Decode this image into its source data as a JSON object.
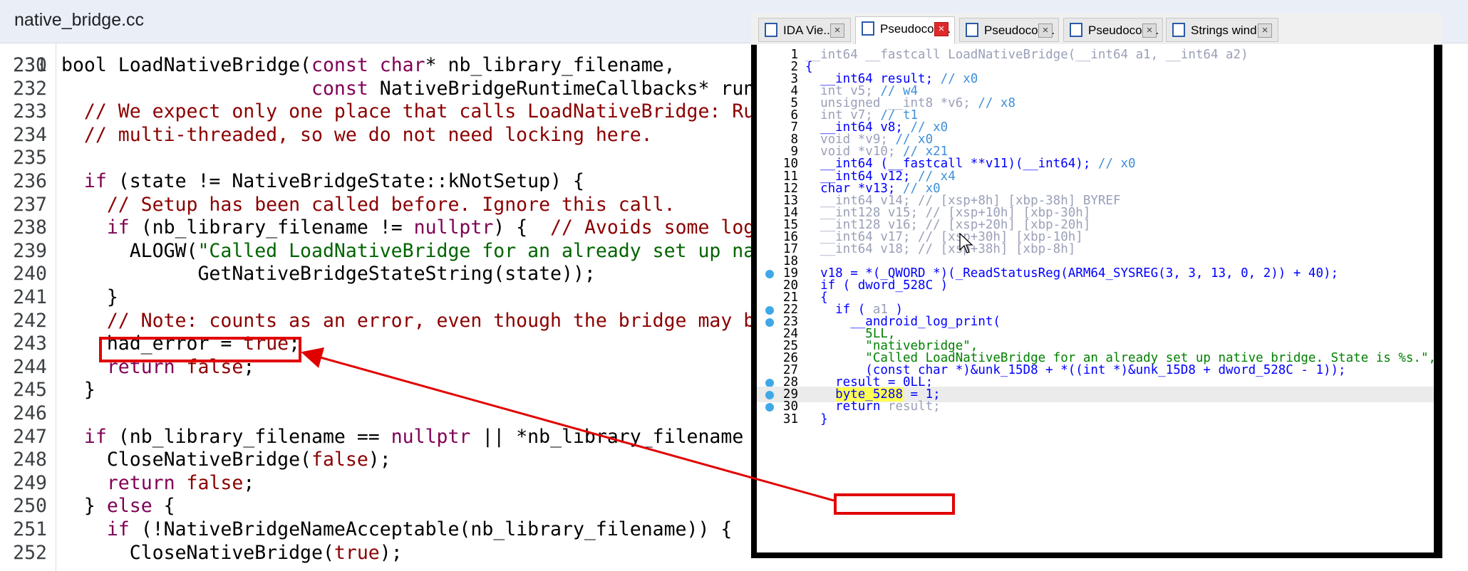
{
  "source_panel": {
    "title": "native_bridge.cc",
    "partial_top_line": "230",
    "lines": [
      {
        "num": "231",
        "segments": [
          {
            "t": "bool LoadNativeBridge(",
            "c": ""
          },
          {
            "t": "const",
            "c": "t-k"
          },
          {
            "t": " ",
            "c": ""
          },
          {
            "t": "char",
            "c": "t-k"
          },
          {
            "t": "* nb_library_filename,",
            "c": ""
          }
        ]
      },
      {
        "num": "232",
        "segments": [
          {
            "t": "                      ",
            "c": ""
          },
          {
            "t": "const",
            "c": "t-k"
          },
          {
            "t": " NativeBridgeRuntimeCallbacks* runt",
            "c": ""
          }
        ]
      },
      {
        "num": "233",
        "segments": [
          {
            "t": "  // We expect only one place that calls LoadNativeBridge: Run",
            "c": "t-c"
          }
        ]
      },
      {
        "num": "234",
        "segments": [
          {
            "t": "  // multi-threaded, so we do not need locking here.",
            "c": "t-c"
          }
        ]
      },
      {
        "num": "235",
        "segments": []
      },
      {
        "num": "236",
        "segments": [
          {
            "t": "  ",
            "c": ""
          },
          {
            "t": "if",
            "c": "t-k"
          },
          {
            "t": " (state != NativeBridgeState::kNotSetup) {",
            "c": ""
          }
        ]
      },
      {
        "num": "237",
        "segments": [
          {
            "t": "    // Setup has been called before. Ignore this call.",
            "c": "t-c"
          }
        ]
      },
      {
        "num": "238",
        "segments": [
          {
            "t": "    ",
            "c": ""
          },
          {
            "t": "if",
            "c": "t-k"
          },
          {
            "t": " (nb_library_filename != ",
            "c": ""
          },
          {
            "t": "nullptr",
            "c": "t-n"
          },
          {
            "t": ") {  ",
            "c": ""
          },
          {
            "t": "// Avoids some log-",
            "c": "t-c"
          }
        ]
      },
      {
        "num": "239",
        "segments": [
          {
            "t": "      ALOGW(",
            "c": ""
          },
          {
            "t": "\"Called LoadNativeBridge for an already set up nat",
            "c": "t-s"
          }
        ]
      },
      {
        "num": "240",
        "segments": [
          {
            "t": "            GetNativeBridgeStateString(state));",
            "c": ""
          }
        ]
      },
      {
        "num": "241",
        "segments": [
          {
            "t": "    }",
            "c": ""
          }
        ]
      },
      {
        "num": "242",
        "segments": [
          {
            "t": "    // Note: counts as an error, even though the bridge may be",
            "c": "t-c"
          }
        ]
      },
      {
        "num": "243",
        "segments": [
          {
            "t": "    had_error = ",
            "c": ""
          },
          {
            "t": "true",
            "c": "t-b"
          },
          {
            "t": ";",
            "c": ""
          }
        ]
      },
      {
        "num": "244",
        "segments": [
          {
            "t": "    ",
            "c": ""
          },
          {
            "t": "return",
            "c": "t-k"
          },
          {
            "t": " ",
            "c": ""
          },
          {
            "t": "false",
            "c": "t-b"
          },
          {
            "t": ";",
            "c": ""
          }
        ]
      },
      {
        "num": "245",
        "segments": [
          {
            "t": "  }",
            "c": ""
          }
        ]
      },
      {
        "num": "246",
        "segments": []
      },
      {
        "num": "247",
        "segments": [
          {
            "t": "  ",
            "c": ""
          },
          {
            "t": "if",
            "c": "t-k"
          },
          {
            "t": " (nb_library_filename == ",
            "c": ""
          },
          {
            "t": "nullptr",
            "c": "t-n"
          },
          {
            "t": " || *nb_library_filename =",
            "c": ""
          }
        ]
      },
      {
        "num": "248",
        "segments": [
          {
            "t": "    CloseNativeBridge(",
            "c": ""
          },
          {
            "t": "false",
            "c": "t-b"
          },
          {
            "t": ");",
            "c": ""
          }
        ]
      },
      {
        "num": "249",
        "segments": [
          {
            "t": "    ",
            "c": ""
          },
          {
            "t": "return",
            "c": "t-k"
          },
          {
            "t": " ",
            "c": ""
          },
          {
            "t": "false",
            "c": "t-b"
          },
          {
            "t": ";",
            "c": ""
          }
        ]
      },
      {
        "num": "250",
        "segments": [
          {
            "t": "  } ",
            "c": ""
          },
          {
            "t": "else",
            "c": "t-k"
          },
          {
            "t": " {",
            "c": ""
          }
        ]
      },
      {
        "num": "251",
        "segments": [
          {
            "t": "    ",
            "c": ""
          },
          {
            "t": "if",
            "c": "t-k"
          },
          {
            "t": " (!NativeBridgeNameAcceptable(nb_library_filename)) {",
            "c": ""
          }
        ]
      },
      {
        "num": "252",
        "segments": [
          {
            "t": "      CloseNativeBridge(",
            "c": ""
          },
          {
            "t": "true",
            "c": "t-b"
          },
          {
            "t": ");",
            "c": ""
          }
        ]
      }
    ]
  },
  "ida": {
    "tabs": [
      {
        "label": "IDA Vie...",
        "icon": "ida-view-icon",
        "active": false,
        "close_red": false
      },
      {
        "label": "Pseudocod...",
        "icon": "pseudocode-icon",
        "active": true,
        "close_red": true
      },
      {
        "label": "Pseudocod...",
        "icon": "pseudocode-icon",
        "active": false,
        "close_red": false
      },
      {
        "label": "Pseudocod...",
        "icon": "pseudocode-icon",
        "active": false,
        "close_red": false
      },
      {
        "label": "Strings wind...",
        "icon": "strings-icon",
        "active": false,
        "close_red": false
      }
    ],
    "lines": [
      {
        "num": "1",
        "dot": false,
        "segments": [
          {
            "t": "__int64 __fastcall LoadNativeBridge(__int64 a1, __int64 a2)",
            "c": "v-l"
          }
        ]
      },
      {
        "num": "2",
        "dot": false,
        "segments": [
          {
            "t": "{",
            "c": "v-b"
          }
        ]
      },
      {
        "num": "3",
        "dot": false,
        "segments": [
          {
            "t": "  __int64 result; ",
            "c": "v-b"
          },
          {
            "t": "// x0",
            "c": "v-c"
          }
        ]
      },
      {
        "num": "4",
        "dot": false,
        "segments": [
          {
            "t": "  int v5; ",
            "c": "v-l"
          },
          {
            "t": "// w4",
            "c": "v-c"
          }
        ]
      },
      {
        "num": "5",
        "dot": false,
        "segments": [
          {
            "t": "  unsigned __int8 *v6; ",
            "c": "v-l"
          },
          {
            "t": "// x8",
            "c": "v-c"
          }
        ]
      },
      {
        "num": "6",
        "dot": false,
        "segments": [
          {
            "t": "  int v7; ",
            "c": "v-l"
          },
          {
            "t": "// t1",
            "c": "v-c"
          }
        ]
      },
      {
        "num": "7",
        "dot": false,
        "segments": [
          {
            "t": "  __int64 v8; ",
            "c": "v-b"
          },
          {
            "t": "// x0",
            "c": "v-c"
          }
        ]
      },
      {
        "num": "8",
        "dot": false,
        "segments": [
          {
            "t": "  void *v9; ",
            "c": "v-l"
          },
          {
            "t": "// x0",
            "c": "v-c"
          }
        ]
      },
      {
        "num": "9",
        "dot": false,
        "segments": [
          {
            "t": "  void *v10; ",
            "c": "v-l"
          },
          {
            "t": "// x21",
            "c": "v-c"
          }
        ]
      },
      {
        "num": "10",
        "dot": false,
        "segments": [
          {
            "t": "  __int64 (__fastcall **v11)(__int64); ",
            "c": "v-b"
          },
          {
            "t": "// x0",
            "c": "v-c"
          }
        ]
      },
      {
        "num": "11",
        "dot": false,
        "segments": [
          {
            "t": "  __int64 v12; ",
            "c": "v-b"
          },
          {
            "t": "// x4",
            "c": "v-c"
          }
        ]
      },
      {
        "num": "12",
        "dot": false,
        "segments": [
          {
            "t": "  char *v13; ",
            "c": "v-b"
          },
          {
            "t": "// x0",
            "c": "v-c"
          }
        ]
      },
      {
        "num": "13",
        "dot": false,
        "segments": [
          {
            "t": "  __int64 v14; // [xsp+8h] [xbp-38h] BYREF",
            "c": "v-l"
          }
        ]
      },
      {
        "num": "14",
        "dot": false,
        "segments": [
          {
            "t": "  __int128 v15; // [xsp+10h] [xbp-30h]",
            "c": "v-l"
          }
        ]
      },
      {
        "num": "15",
        "dot": false,
        "segments": [
          {
            "t": "  __int128 v16; // [xsp+20h] [xbp-20h]",
            "c": "v-l"
          }
        ]
      },
      {
        "num": "16",
        "dot": false,
        "segments": [
          {
            "t": "  __int64 v17; // [xsp+30h] [xbp-10h]",
            "c": "v-l"
          }
        ]
      },
      {
        "num": "17",
        "dot": false,
        "segments": [
          {
            "t": "  __int64 v18; // [xsp+38h] [xbp-8h]",
            "c": "v-l"
          }
        ]
      },
      {
        "num": "18",
        "dot": false,
        "segments": []
      },
      {
        "num": "19",
        "dot": true,
        "segments": [
          {
            "t": "  v18 = *(_QWORD *)(_ReadStatusReg(ARM64_SYSREG(3, 3, 13, 0, 2)) + 40);",
            "c": "v-b"
          }
        ]
      },
      {
        "num": "20",
        "dot": false,
        "segments": [
          {
            "t": "  if ( dword_528C )",
            "c": "v-b"
          }
        ]
      },
      {
        "num": "21",
        "dot": false,
        "segments": [
          {
            "t": "  {",
            "c": "v-b"
          }
        ]
      },
      {
        "num": "22",
        "dot": true,
        "segments": [
          {
            "t": "    if ( ",
            "c": "v-b"
          },
          {
            "t": "a1",
            "c": "v-l"
          },
          {
            "t": " )",
            "c": "v-b"
          }
        ]
      },
      {
        "num": "23",
        "dot": true,
        "segments": [
          {
            "t": "      __android_log_print(",
            "c": "v-b"
          }
        ]
      },
      {
        "num": "24",
        "dot": false,
        "segments": [
          {
            "t": "        5LL,",
            "c": "v-g"
          }
        ]
      },
      {
        "num": "25",
        "dot": false,
        "segments": [
          {
            "t": "        \"nativebridge\",",
            "c": "v-g"
          }
        ]
      },
      {
        "num": "26",
        "dot": false,
        "segments": [
          {
            "t": "        \"Called LoadNativeBridge for an already set up native bridge. State is %s.\",",
            "c": "v-g"
          }
        ]
      },
      {
        "num": "27",
        "dot": false,
        "segments": [
          {
            "t": "        (const char *)&unk_15D8 + *((int *)&unk_15D8 + dword_528C - 1));",
            "c": "v-b"
          }
        ]
      },
      {
        "num": "28",
        "dot": true,
        "segments": [
          {
            "t": "    result = 0LL;",
            "c": "v-b"
          }
        ]
      },
      {
        "num": "29",
        "dot": true,
        "cur": true,
        "segments": [
          {
            "t": "    ",
            "c": ""
          },
          {
            "t": "byte_5288",
            "c": "v-b hl-yellow"
          },
          {
            "t": " = 1;",
            "c": "v-b"
          }
        ]
      },
      {
        "num": "30",
        "dot": true,
        "segments": [
          {
            "t": "    return ",
            "c": "v-b"
          },
          {
            "t": "result;",
            "c": "v-l"
          }
        ]
      },
      {
        "num": "31",
        "dot": false,
        "segments": [
          {
            "t": "  }",
            "c": "v-b"
          }
        ]
      }
    ]
  },
  "colors": {
    "highlight_box": "#e10000",
    "arrow": "#e10000",
    "breakpoint_dot": "#3fa8e8",
    "ida_window_frame": "#000000"
  }
}
